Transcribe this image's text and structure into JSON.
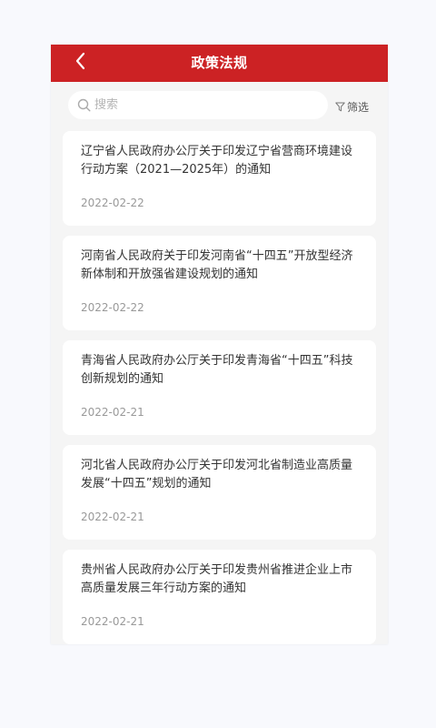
{
  "header": {
    "title": "政策法规",
    "back_icon": "chevron-left-icon",
    "background_color": "#cc2224"
  },
  "search": {
    "placeholder": "搜索",
    "icon": "search-icon"
  },
  "filter": {
    "label": "筛选",
    "icon": "filter-icon"
  },
  "articles": [
    {
      "title": "辽宁省人民政府办公厅关于印发辽宁省营商环境建设行动方案（2021—2025年）的通知",
      "date": "2022-02-22"
    },
    {
      "title": "河南省人民政府关于印发河南省“十四五”开放型经济新体制和开放强省建设规划的通知",
      "date": "2022-02-22"
    },
    {
      "title": "青海省人民政府办公厅关于印发青海省“十四五”科技创新规划的通知",
      "date": "2022-02-21"
    },
    {
      "title": "河北省人民政府办公厅关于印发河北省制造业高质量发展“十四五”规划的通知",
      "date": "2022-02-21"
    },
    {
      "title": "贵州省人民政府办公厅关于印发贵州省推进企业上市高质量发展三年行动方案的通知",
      "date": "2022-02-21"
    }
  ]
}
